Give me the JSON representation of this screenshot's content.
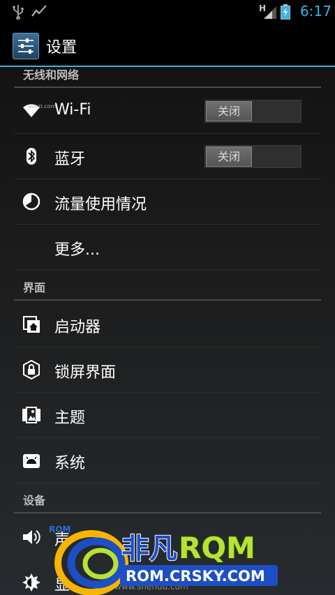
{
  "status_bar": {
    "time": "6:17",
    "network_type": "H",
    "icons": [
      "usb-icon",
      "activity-icon",
      "signal-icon",
      "battery-icon"
    ]
  },
  "action_bar": {
    "title": "设置",
    "app_icon": "settings-sliders-icon"
  },
  "sections": [
    {
      "header": "无线和网络",
      "items": [
        {
          "label": "Wi-Fi",
          "icon": "wifi-icon",
          "toggle": "关闭"
        },
        {
          "label": "蓝牙",
          "icon": "bluetooth-icon",
          "toggle": "关闭"
        },
        {
          "label": "流量使用情况",
          "icon": "data-usage-icon"
        },
        {
          "label": "更多..."
        }
      ]
    },
    {
      "header": "界面",
      "items": [
        {
          "label": "启动器",
          "icon": "launcher-icon"
        },
        {
          "label": "锁屏界面",
          "icon": "lock-icon"
        },
        {
          "label": "主题",
          "icon": "theme-icon"
        },
        {
          "label": "系统",
          "icon": "android-icon"
        }
      ]
    },
    {
      "header": "设备",
      "items": [
        {
          "label": "声",
          "icon": "volume-icon"
        },
        {
          "label": "显",
          "icon": "brightness-icon"
        }
      ]
    }
  ],
  "watermark": {
    "text1": "非凡",
    "text2": "RQM",
    "url": "ROM.CRSKY.COM",
    "small_rom": "ROM",
    "shendu": "www.shendu.com",
    "tiny": "sonzi.com"
  },
  "colors": {
    "accent": "#33b5e5",
    "header_text": "#bdbdbd",
    "watermark_green": "#b8e236",
    "watermark_blue": "#1d4fc4"
  }
}
